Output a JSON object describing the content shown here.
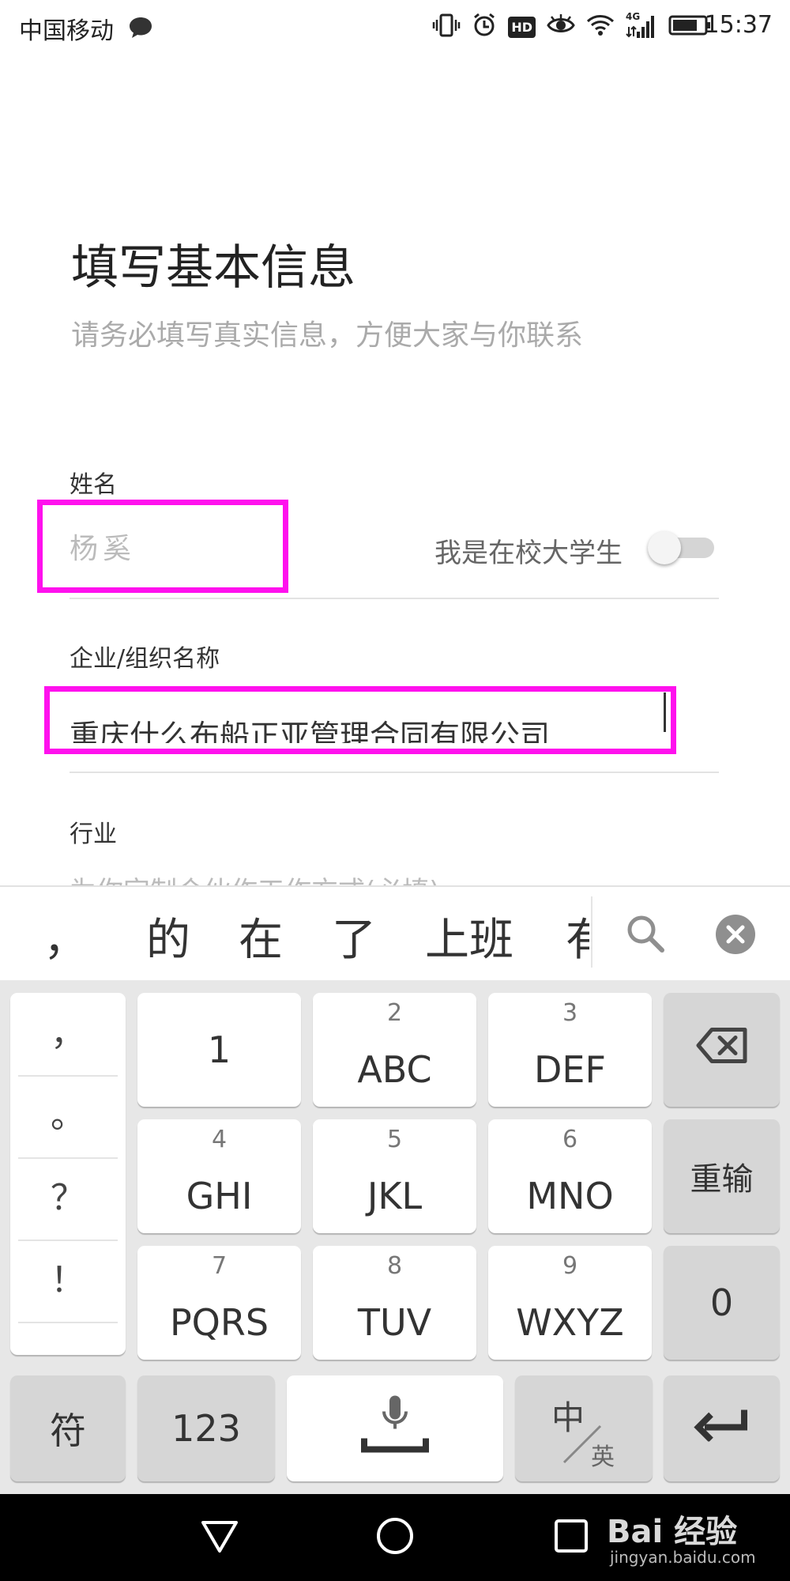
{
  "status_bar": {
    "carrier": "中国移动",
    "network_badge": "4G",
    "hd_badge": "HD",
    "time": "15:37"
  },
  "header": {
    "title": "填写基本信息",
    "subtitle": "请务必填写真实信息，方便大家与你联系"
  },
  "form": {
    "name_label": "姓名",
    "name_value": "杨奚",
    "student_label": "我是在校大学生",
    "student_toggle_on": false,
    "org_label": "企业/组织名称",
    "org_value": "重庆什么布船正亚管理合同有限公司",
    "industry_label": "行业",
    "industry_placeholder": "为你定制合伙作工作方式(必填)"
  },
  "candidates": {
    "items": [
      "，",
      "的",
      "在",
      "了",
      "上班",
      "有"
    ]
  },
  "keyboard": {
    "punctuation": [
      "，",
      "。",
      "？",
      "！"
    ],
    "keys": {
      "k1": {
        "main": "1"
      },
      "k2": {
        "num": "2",
        "main": "ABC"
      },
      "k3": {
        "num": "3",
        "main": "DEF"
      },
      "k4": {
        "num": "4",
        "main": "GHI"
      },
      "k5": {
        "num": "5",
        "main": "JKL"
      },
      "k6": {
        "num": "6",
        "main": "MNO"
      },
      "k7": {
        "num": "7",
        "main": "PQRS"
      },
      "k8": {
        "num": "8",
        "main": "TUV"
      },
      "k9": {
        "num": "9",
        "main": "WXYZ"
      },
      "k0": {
        "main": "0"
      }
    },
    "reinput_label": "重输",
    "symbol_label": "符",
    "number_label": "123",
    "lang_main": "中",
    "lang_sub": "英"
  },
  "watermark": {
    "text": "Bai 经验",
    "url_text": "jingyan.baidu.com"
  },
  "colors": {
    "highlight": "#ff11ee",
    "keyboard_bg": "#e7e7e7",
    "key_gray": "#d6d6d6"
  }
}
